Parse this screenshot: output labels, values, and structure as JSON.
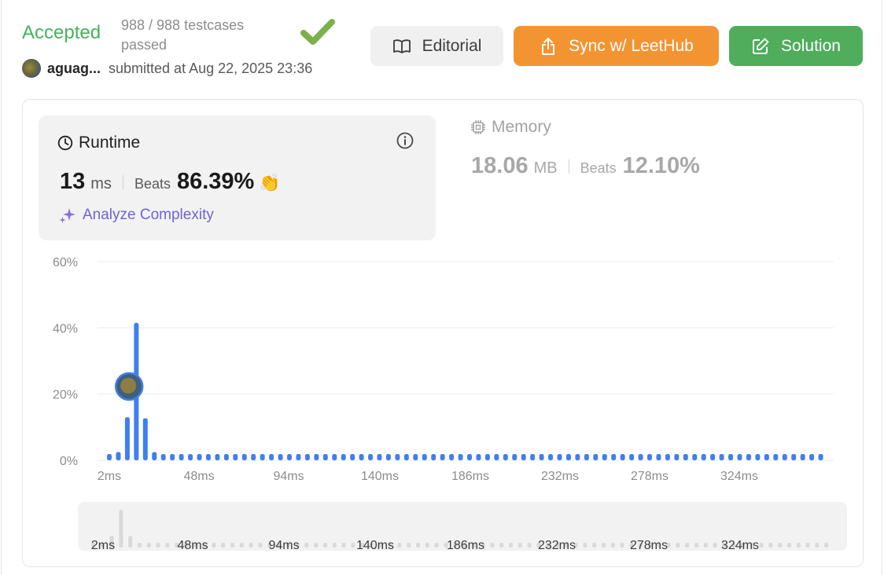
{
  "header": {
    "status": "Accepted",
    "testcases": "988 / 988 testcases passed",
    "username": "aguag...",
    "submitted": "submitted at Aug 22, 2025 23:36"
  },
  "buttons": {
    "editorial": "Editorial",
    "sync": "Sync w/ LeetHub",
    "solution": "Solution"
  },
  "runtime": {
    "title": "Runtime",
    "value": "13",
    "unit": "ms",
    "beats_label": "Beats",
    "beats_pct": "86.39%",
    "analyze": "Analyze Complexity"
  },
  "memory": {
    "title": "Memory",
    "value": "18.06",
    "unit": "MB",
    "beats_label": "Beats",
    "beats_pct": "12.10%"
  },
  "colors": {
    "accepted": "#45b35a",
    "bar": "#3f7ff0",
    "sync": "#f39433",
    "solution": "#4fad5b",
    "analyze": "#6f63d8"
  },
  "chart_data": {
    "type": "bar",
    "y_ticks": [
      "60%",
      "40%",
      "20%",
      "0%"
    ],
    "x_ticks": [
      "2ms",
      "48ms",
      "94ms",
      "140ms",
      "186ms",
      "232ms",
      "278ms",
      "324ms"
    ],
    "ylim": [
      0,
      60
    ],
    "grid": true,
    "user_runtime_ms": 13,
    "bucket_ms": 4.6,
    "values": [
      0.6,
      2.5,
      13.0,
      41.5,
      12.7,
      2.5
    ]
  },
  "overview_ticks": [
    "2ms",
    "48ms",
    "94ms",
    "140ms",
    "186ms",
    "232ms",
    "278ms",
    "324ms"
  ]
}
